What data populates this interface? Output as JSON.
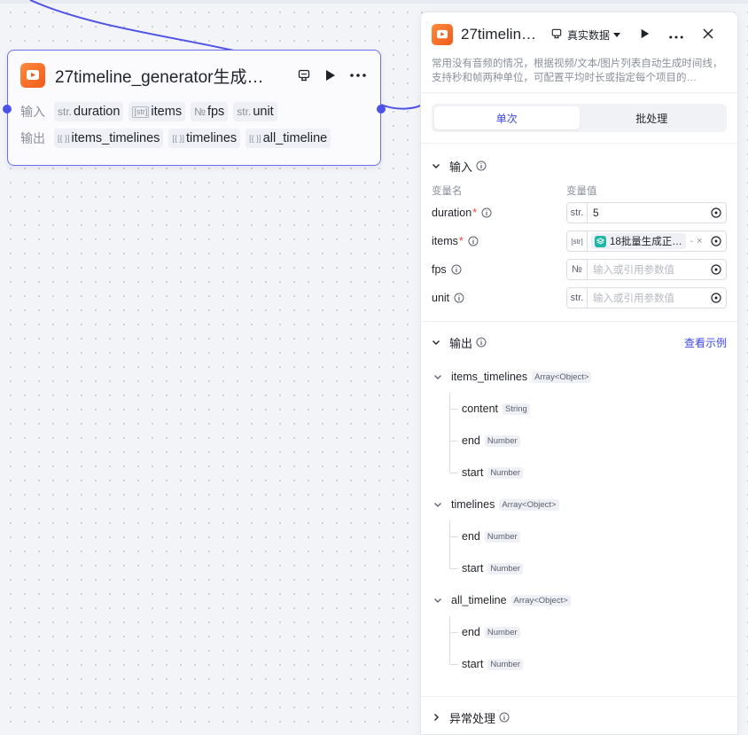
{
  "node": {
    "title": "27timeline_generator生成…",
    "input_label": "输入",
    "output_label": "输出",
    "inputs": [
      {
        "type": "str.",
        "name": "duration"
      },
      {
        "type": "[str]",
        "name": "items"
      },
      {
        "type": "№",
        "name": "fps"
      },
      {
        "type": "str.",
        "name": "unit"
      }
    ],
    "outputs": [
      {
        "type": "[{ }]",
        "name": "items_timelines"
      },
      {
        "type": "[{ }]",
        "name": "timelines"
      },
      {
        "type": "[{ }]",
        "name": "all_timeline"
      }
    ]
  },
  "panel": {
    "title": "27timelin…",
    "mode_label": "真实数据",
    "description": "常用没有音频的情况，根据视频/文本/图片列表自动生成时间线，支持秒和帧两种单位，可配置平均时长或指定每个项目的…",
    "tabs": [
      "单次",
      "批处理"
    ],
    "input_section": "输入",
    "col_name": "变量名",
    "col_value": "变量值",
    "inputs": [
      {
        "name": "duration",
        "required": "*",
        "type": "str.",
        "value": "5"
      },
      {
        "name": "items",
        "required": "*",
        "type": "[str]",
        "ref": "18批量生成正…",
        "ref_suffix": "-",
        "ref_clear": "×"
      },
      {
        "name": "fps",
        "required": "",
        "type": "№",
        "placeholder": "输入或引用参数值"
      },
      {
        "name": "unit",
        "required": "",
        "type": "str.",
        "placeholder": "输入或引用参数值"
      }
    ],
    "output_section": "输出",
    "view_example": "查看示例",
    "outputs": [
      {
        "name": "items_timelines",
        "type": "Array<Object>",
        "children": [
          {
            "name": "content",
            "type": "String"
          },
          {
            "name": "end",
            "type": "Number"
          },
          {
            "name": "start",
            "type": "Number"
          }
        ]
      },
      {
        "name": "timelines",
        "type": "Array<Object>",
        "children": [
          {
            "name": "end",
            "type": "Number"
          },
          {
            "name": "start",
            "type": "Number"
          }
        ]
      },
      {
        "name": "all_timeline",
        "type": "Array<Object>",
        "children": [
          {
            "name": "end",
            "type": "Number"
          },
          {
            "name": "start",
            "type": "Number"
          }
        ]
      }
    ],
    "exception_section": "异常处理"
  },
  "colors": {
    "accent": "#3d46e6",
    "node_border": "#6b6ef0",
    "icon_orange": "#f05a1a"
  }
}
